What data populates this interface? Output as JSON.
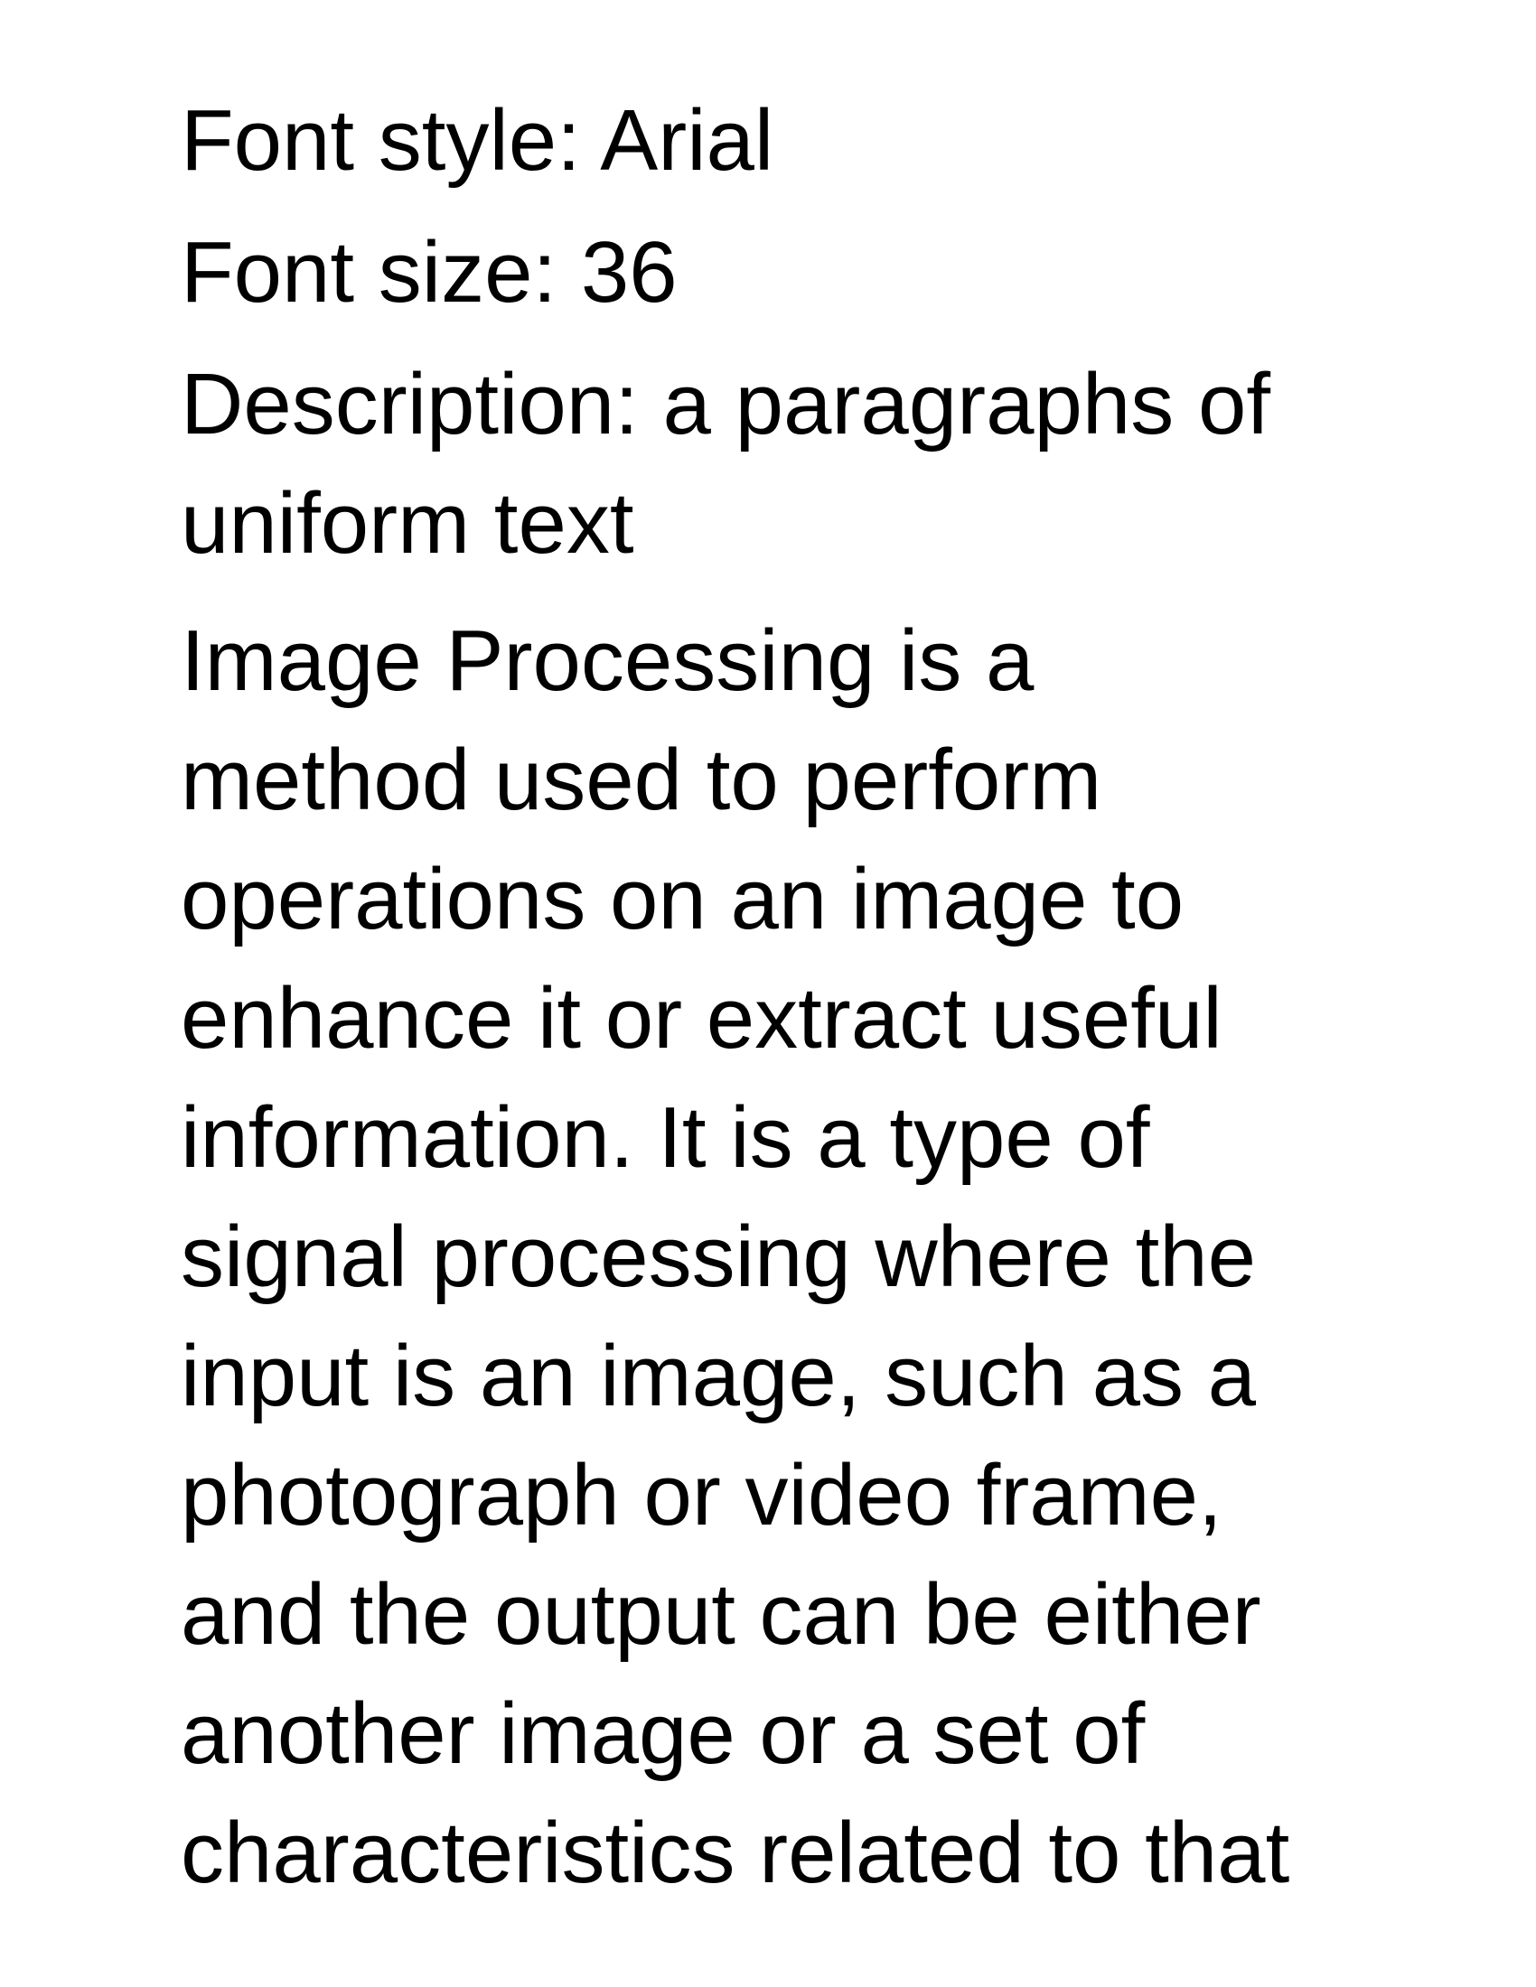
{
  "meta": {
    "font_style": "Font style: Arial",
    "font_size": "Font size: 36",
    "description_lines": [
      "Description: a paragraphs of",
      "uniform text"
    ]
  },
  "paragraph": {
    "lines": [
      "Image Processing is a",
      "method used to perform",
      "operations on an image to",
      "enhance it or extract useful",
      "information. It is a type of",
      "signal processing where the",
      "input is an image, such as a",
      "photograph or video frame,",
      "and the output can be either",
      "another image or a set of",
      "characteristics related to that"
    ]
  }
}
